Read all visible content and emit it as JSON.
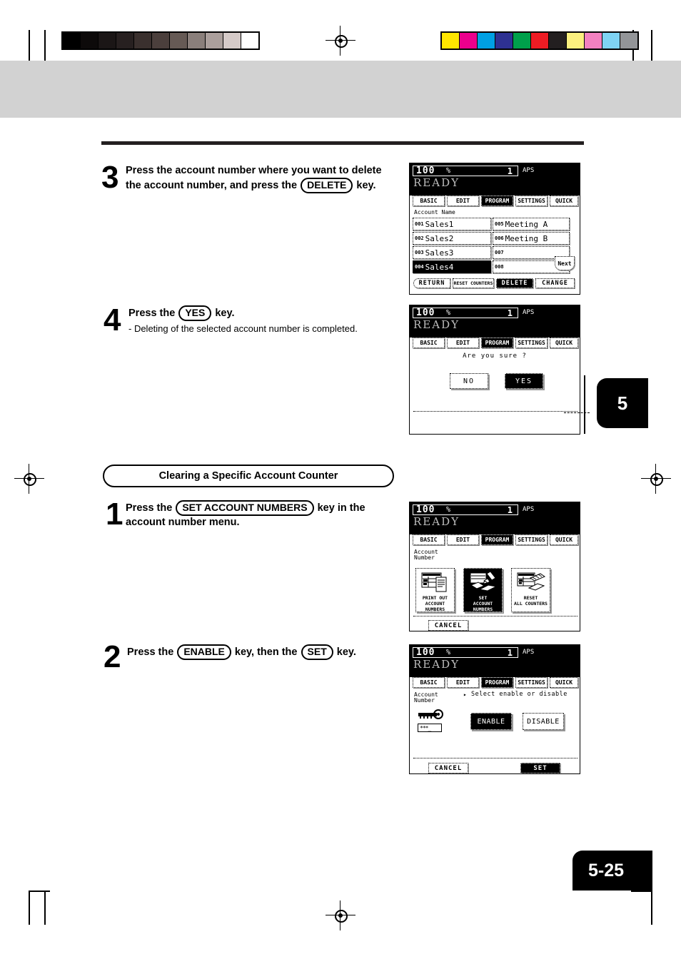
{
  "page": {
    "number": "5-25",
    "chapter_tab": "5"
  },
  "calibration": {
    "grayscale_swatches": [
      "#000000",
      "#0d0a0a",
      "#1b1616",
      "#272020",
      "#3a302e",
      "#4b3f3c",
      "#665a55",
      "#8a7f7b",
      "#ab9f9c",
      "#d5cac8",
      "#ffffff"
    ],
    "color_swatches": [
      "#ffe600",
      "#ec008c",
      "#00a0e3",
      "#2e3192",
      "#00a04b",
      "#ed1c24",
      "#231f20",
      "#fbf07f",
      "#f381c0",
      "#7fd4f4",
      "#939598"
    ]
  },
  "steps": [
    {
      "number": "3",
      "line1_pre": "Press the account number where you want to delete",
      "line2_pre": "the account number, and press the ",
      "key": "DELETE",
      "line2_post": " key.",
      "sub": ""
    },
    {
      "number": "4",
      "line1_pre": "Press the ",
      "key": "YES",
      "line1_post": " key.",
      "sub": "- Deleting of the selected account number is completed."
    },
    {
      "number": "1",
      "line1_pre": "Press the ",
      "key": "SET ACCOUNT NUMBERS",
      "line1_post": " key  in  the",
      "line2": "account number menu.",
      "sub": ""
    },
    {
      "number": "2",
      "line1_pre": "Press the ",
      "key": "ENABLE",
      "mid": " key, then the ",
      "key2": "SET",
      "line1_post": " key.",
      "sub": ""
    }
  ],
  "section_title": "Clearing a Specific Account Counter",
  "lcd_common": {
    "ratio": "100",
    "percent": "%",
    "count": "1",
    "paper_mode": "APS",
    "status": "READY",
    "tabs": [
      {
        "label": "BASIC",
        "active": false
      },
      {
        "label": "EDIT",
        "active": false
      },
      {
        "label": "PROGRAM",
        "active": true
      },
      {
        "label": "SETTINGS",
        "active": false
      },
      {
        "label": "QUICK",
        "active": false
      }
    ]
  },
  "lcd_account_list": {
    "header": "Account Name",
    "rows_left": [
      {
        "idx": "001",
        "name": "Sales1",
        "selected": false
      },
      {
        "idx": "002",
        "name": "Sales2",
        "selected": false
      },
      {
        "idx": "003",
        "name": "Sales3",
        "selected": false
      },
      {
        "idx": "004",
        "name": "Sales4",
        "selected": true
      }
    ],
    "rows_right": [
      {
        "idx": "005",
        "name": "Meeting A",
        "selected": false
      },
      {
        "idx": "006",
        "name": "Meeting B",
        "selected": false
      },
      {
        "idx": "007",
        "name": "",
        "selected": false
      },
      {
        "idx": "008",
        "name": "",
        "selected": false
      }
    ],
    "next_label": "Next",
    "bottom_buttons": [
      {
        "label": "RETURN",
        "active": false
      },
      {
        "label": "RESET COUNTERS",
        "active": false
      },
      {
        "label": "DELETE",
        "active": true
      },
      {
        "label": "CHANGE",
        "active": false
      }
    ]
  },
  "lcd_confirm": {
    "message": "Are you sure ?",
    "buttons": [
      {
        "label": "NO",
        "active": false
      },
      {
        "label": "YES",
        "active": true
      }
    ]
  },
  "lcd_account_menu": {
    "label_line1": "Account",
    "label_line2": "Number",
    "tiles": [
      {
        "cap1": "PRINT OUT",
        "cap2": "ACCOUNT NUMBERS",
        "icon": "printout-list-icon",
        "active": false
      },
      {
        "cap1": "SET",
        "cap2": "ACCOUNT NUMBERS",
        "icon": "set-account-numbers-icon",
        "active": true
      },
      {
        "cap1": "RESET",
        "cap2": "ALL COUNTERS",
        "icon": "reset-all-counters-icon",
        "active": false
      }
    ],
    "cancel_label": "CANCEL"
  },
  "lcd_enable_disable": {
    "label_line1": "Account",
    "label_line2": "Number",
    "prompt": "Select enable or disable",
    "password_mask": "***_",
    "buttons": [
      {
        "label": "ENABLE",
        "active": true
      },
      {
        "label": "DISABLE",
        "active": false
      }
    ],
    "cancel_label": "CANCEL",
    "set_label": "SET"
  }
}
